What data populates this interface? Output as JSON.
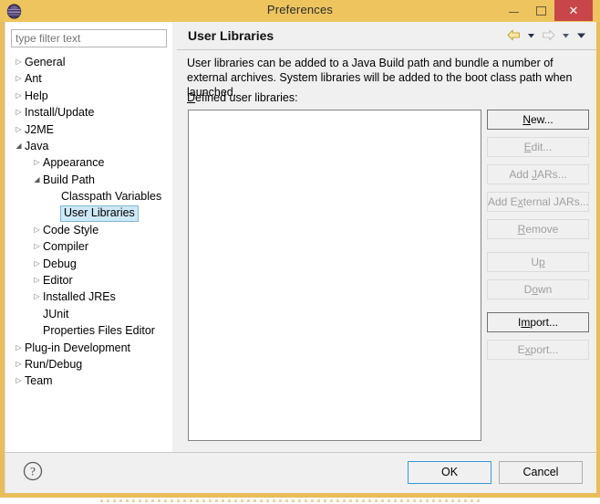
{
  "window": {
    "title": "Preferences",
    "app_icon": "eclipse-sphere-icon",
    "controls": {
      "minimize": "minimize-icon",
      "maximize": "maximize-icon",
      "close": "✕"
    },
    "colors": {
      "titlebar": "#edc45e",
      "frame": "#e8bd5a",
      "close_button": "#c8454a",
      "selection": "#cde8f6",
      "selection_border": "#7fb8d8",
      "default_button_border": "#3c97d4"
    }
  },
  "filter": {
    "placeholder": "type filter text",
    "value": ""
  },
  "tree": {
    "items": [
      {
        "label": "General",
        "indent": 0,
        "state": "collapsed",
        "selected": false
      },
      {
        "label": "Ant",
        "indent": 0,
        "state": "collapsed",
        "selected": false
      },
      {
        "label": "Help",
        "indent": 0,
        "state": "collapsed",
        "selected": false
      },
      {
        "label": "Install/Update",
        "indent": 0,
        "state": "collapsed",
        "selected": false
      },
      {
        "label": "J2ME",
        "indent": 0,
        "state": "collapsed",
        "selected": false
      },
      {
        "label": "Java",
        "indent": 0,
        "state": "expanded",
        "selected": false
      },
      {
        "label": "Appearance",
        "indent": 1,
        "state": "collapsed",
        "selected": false
      },
      {
        "label": "Build Path",
        "indent": 1,
        "state": "expanded",
        "selected": false
      },
      {
        "label": "Classpath Variables",
        "indent": 2,
        "state": "leaf",
        "selected": false
      },
      {
        "label": "User Libraries",
        "indent": 2,
        "state": "leaf",
        "selected": true
      },
      {
        "label": "Code Style",
        "indent": 1,
        "state": "collapsed",
        "selected": false
      },
      {
        "label": "Compiler",
        "indent": 1,
        "state": "collapsed",
        "selected": false
      },
      {
        "label": "Debug",
        "indent": 1,
        "state": "collapsed",
        "selected": false
      },
      {
        "label": "Editor",
        "indent": 1,
        "state": "collapsed",
        "selected": false
      },
      {
        "label": "Installed JREs",
        "indent": 1,
        "state": "collapsed",
        "selected": false
      },
      {
        "label": "JUnit",
        "indent": 1,
        "state": "leaf",
        "selected": false
      },
      {
        "label": "Properties Files Editor",
        "indent": 1,
        "state": "leaf",
        "selected": false
      },
      {
        "label": "Plug-in Development",
        "indent": 0,
        "state": "collapsed",
        "selected": false
      },
      {
        "label": "Run/Debug",
        "indent": 0,
        "state": "collapsed",
        "selected": false
      },
      {
        "label": "Team",
        "indent": 0,
        "state": "collapsed",
        "selected": false
      }
    ]
  },
  "page": {
    "title": "User Libraries",
    "nav": {
      "back_icon": "back-arrow-icon",
      "back_menu_icon": "chevron-down-icon",
      "forward_icon": "forward-arrow-icon",
      "forward_menu_icon": "chevron-down-icon",
      "view_menu_icon": "chevron-down-icon"
    },
    "description": "User libraries can be added to a Java Build path and bundle a number of external archives. System libraries will be added to the boot class path when launched.",
    "defined_label_mnemonic": "D",
    "defined_label_rest": "efined user libraries:",
    "list_items": []
  },
  "side_buttons": [
    {
      "name": "new-button",
      "pre": "",
      "mnemonic": "N",
      "post": "ew...",
      "enabled": true,
      "gap": "none"
    },
    {
      "name": "edit-button",
      "pre": "",
      "mnemonic": "E",
      "post": "dit...",
      "enabled": false,
      "gap": "none"
    },
    {
      "name": "add-jars-button",
      "pre": "Add ",
      "mnemonic": "J",
      "post": "ARs...",
      "enabled": false,
      "gap": "small"
    },
    {
      "name": "add-external-jars-button",
      "pre": "Add E",
      "mnemonic": "x",
      "post": "ternal JARs...",
      "enabled": false,
      "gap": "none"
    },
    {
      "name": "remove-button",
      "pre": "",
      "mnemonic": "R",
      "post": "emove",
      "enabled": false,
      "gap": "none"
    },
    {
      "name": "up-button",
      "pre": "U",
      "mnemonic": "p",
      "post": "",
      "enabled": false,
      "gap": "big"
    },
    {
      "name": "down-button",
      "pre": "D",
      "mnemonic": "o",
      "post": "wn",
      "enabled": false,
      "gap": "none"
    },
    {
      "name": "import-button",
      "pre": "I",
      "mnemonic": "m",
      "post": "port...",
      "enabled": true,
      "gap": "big"
    },
    {
      "name": "export-button",
      "pre": "E",
      "mnemonic": "x",
      "post": "port...",
      "enabled": false,
      "gap": "none"
    }
  ],
  "footer": {
    "help_icon": "help-question-icon",
    "ok_label": "OK",
    "cancel_label": "Cancel"
  }
}
